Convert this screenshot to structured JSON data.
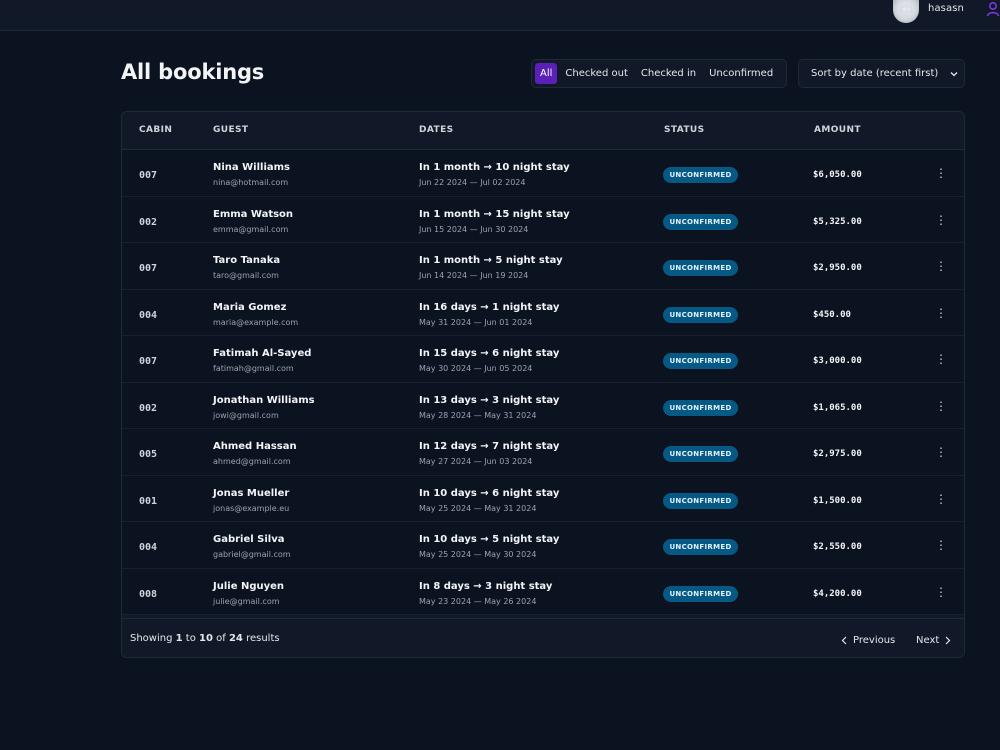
{
  "header": {
    "username": "hasasn"
  },
  "page": {
    "title": "All bookings"
  },
  "filters": {
    "items": [
      "All",
      "Checked out",
      "Checked in",
      "Unconfirmed"
    ],
    "active_index": 0
  },
  "sort": {
    "selected": "Sort by date (recent first)"
  },
  "table": {
    "columns": [
      "CABIN",
      "GUEST",
      "DATES",
      "STATUS",
      "AMOUNT"
    ],
    "rows": [
      {
        "cabin": "007",
        "name": "Nina Williams",
        "email": "nina@hotmail.com",
        "dates_main": "In 1 month → 10 night stay",
        "dates_sub": "Jun 22 2024 — Jul 02 2024",
        "status": "UNCONFIRMED",
        "amount": "$6,050.00"
      },
      {
        "cabin": "002",
        "name": "Emma Watson",
        "email": "emma@gmail.com",
        "dates_main": "In 1 month → 15 night stay",
        "dates_sub": "Jun 15 2024 — Jun 30 2024",
        "status": "UNCONFIRMED",
        "amount": "$5,325.00"
      },
      {
        "cabin": "007",
        "name": "Taro Tanaka",
        "email": "taro@gmail.com",
        "dates_main": "In 1 month → 5 night stay",
        "dates_sub": "Jun 14 2024 — Jun 19 2024",
        "status": "UNCONFIRMED",
        "amount": "$2,950.00"
      },
      {
        "cabin": "004",
        "name": "Maria Gomez",
        "email": "maria@example.com",
        "dates_main": "In 16 days → 1 night stay",
        "dates_sub": "May 31 2024 — Jun 01 2024",
        "status": "UNCONFIRMED",
        "amount": "$450.00"
      },
      {
        "cabin": "007",
        "name": "Fatimah Al-Sayed",
        "email": "fatimah@gmail.com",
        "dates_main": "In 15 days → 6 night stay",
        "dates_sub": "May 30 2024 — Jun 05 2024",
        "status": "UNCONFIRMED",
        "amount": "$3,000.00"
      },
      {
        "cabin": "002",
        "name": "Jonathan Williams",
        "email": "jowi@gmail.com",
        "dates_main": "In 13 days → 3 night stay",
        "dates_sub": "May 28 2024 — May 31 2024",
        "status": "UNCONFIRMED",
        "amount": "$1,065.00"
      },
      {
        "cabin": "005",
        "name": "Ahmed Hassan",
        "email": "ahmed@gmail.com",
        "dates_main": "In 12 days → 7 night stay",
        "dates_sub": "May 27 2024 — Jun 03 2024",
        "status": "UNCONFIRMED",
        "amount": "$2,975.00"
      },
      {
        "cabin": "001",
        "name": "Jonas Mueller",
        "email": "jonas@example.eu",
        "dates_main": "In 10 days → 6 night stay",
        "dates_sub": "May 25 2024 — May 31 2024",
        "status": "UNCONFIRMED",
        "amount": "$1,500.00"
      },
      {
        "cabin": "004",
        "name": "Gabriel Silva",
        "email": "gabriel@gmail.com",
        "dates_main": "In 10 days → 5 night stay",
        "dates_sub": "May 25 2024 — May 30 2024",
        "status": "UNCONFIRMED",
        "amount": "$2,550.00"
      },
      {
        "cabin": "008",
        "name": "Julie Nguyen",
        "email": "julie@gmail.com",
        "dates_main": "In 8 days → 3 night stay",
        "dates_sub": "May 23 2024 — May 26 2024",
        "status": "UNCONFIRMED",
        "amount": "$4,200.00"
      }
    ]
  },
  "pagination": {
    "showing_prefix": "Showing",
    "from": "1",
    "to_word": "to",
    "to": "10",
    "of_word": "of",
    "total": "24",
    "results_word": "results",
    "previous_label": "Previous",
    "next_label": "Next"
  },
  "colors": {
    "background": "#0b1220",
    "panel": "#111827",
    "accent": "#5b21b6",
    "status_badge": "#075985"
  },
  "icons": {
    "user": "user-icon",
    "sort": "chevron-down-icon",
    "row_menu": "more-vertical-icon",
    "prev": "chevron-left-icon",
    "next": "chevron-right-icon"
  }
}
